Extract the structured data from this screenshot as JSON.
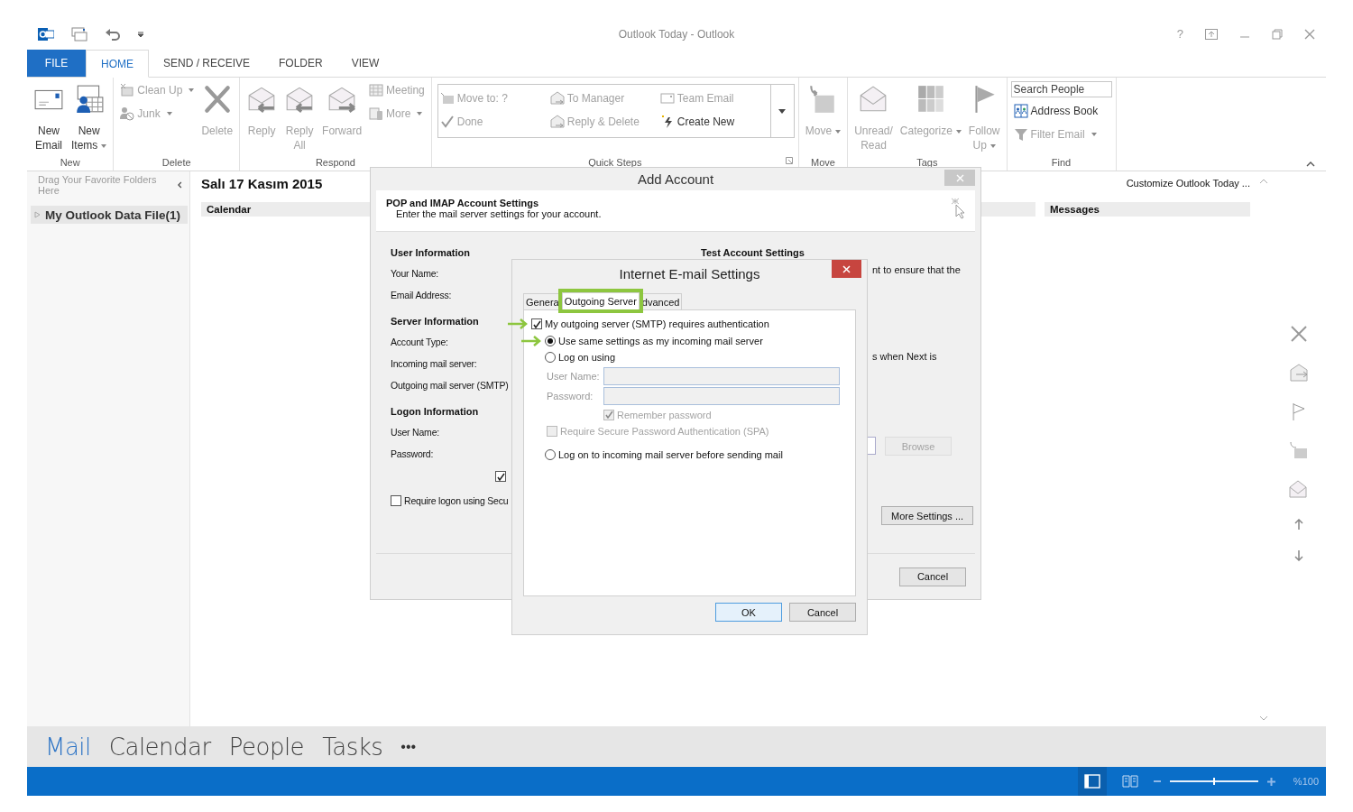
{
  "window": {
    "title": "Outlook Today - Outlook",
    "help": "?"
  },
  "ribbon_tabs": [
    {
      "label": "FILE",
      "kind": "file",
      "selected": false
    },
    {
      "label": "HOME",
      "kind": "tab",
      "selected": true
    },
    {
      "label": "SEND / RECEIVE",
      "kind": "tab",
      "selected": false
    },
    {
      "label": "FOLDER",
      "kind": "tab",
      "selected": false
    },
    {
      "label": "VIEW",
      "kind": "tab",
      "selected": false
    }
  ],
  "ribbon_groups": [
    {
      "label": "New",
      "columns": [
        [
          {
            "kind": "large",
            "label": "New\nEmail",
            "dropdown": false,
            "disabled": false
          }
        ],
        [
          {
            "kind": "large",
            "label": "New\nItems",
            "dropdown": true,
            "disabled": false
          }
        ]
      ]
    },
    {
      "label": "Delete",
      "columns": [
        [
          {
            "kind": "small",
            "label": "Clean Up",
            "dropdown": true,
            "disabled": true
          },
          {
            "kind": "small",
            "label": "Junk",
            "dropdown": true,
            "disabled": true
          }
        ],
        [
          {
            "kind": "large",
            "label": "Delete",
            "dropdown": false,
            "disabled": true
          }
        ]
      ]
    },
    {
      "label": "Respond",
      "columns": [
        [
          {
            "kind": "large",
            "label": "Reply",
            "dropdown": false,
            "disabled": true
          }
        ],
        [
          {
            "kind": "large",
            "label": "Reply\nAll",
            "dropdown": false,
            "disabled": true
          }
        ],
        [
          {
            "kind": "large",
            "label": "Forward",
            "dropdown": false,
            "disabled": true
          }
        ],
        [
          {
            "kind": "small",
            "label": "Meeting",
            "dropdown": false,
            "disabled": true
          },
          {
            "kind": "small",
            "label": "More",
            "dropdown": true,
            "disabled": true
          }
        ]
      ]
    },
    {
      "label": "Quick Steps",
      "launcher": true,
      "gallery": [
        {
          "label": "Move to: ?",
          "disabled": true
        },
        {
          "label": "To Manager",
          "disabled": true
        },
        {
          "label": "Team Email",
          "disabled": true
        },
        {
          "label": "Done",
          "disabled": true
        },
        {
          "label": "Reply & Delete",
          "disabled": true
        },
        {
          "label": "Create New",
          "disabled": false
        }
      ]
    },
    {
      "label": "Move",
      "columns": [
        [
          {
            "kind": "large",
            "label": "Move",
            "dropdown": true,
            "disabled": true
          }
        ]
      ]
    },
    {
      "label": "Tags",
      "columns": [
        [
          {
            "kind": "large",
            "label": "Unread/\nRead",
            "dropdown": false,
            "disabled": true
          }
        ],
        [
          {
            "kind": "large",
            "label": "Categorize",
            "dropdown": true,
            "disabled": true
          }
        ],
        [
          {
            "kind": "large",
            "label": "Follow\nUp",
            "dropdown": true,
            "disabled": true
          }
        ]
      ]
    },
    {
      "label": "Find",
      "columns": [
        [
          {
            "kind": "search",
            "placeholder": "Search People"
          },
          {
            "kind": "small",
            "label": "Address Book",
            "dropdown": false,
            "disabled": false
          },
          {
            "kind": "small",
            "label": "Filter Email",
            "dropdown": true,
            "disabled": true
          }
        ]
      ]
    }
  ],
  "folder_pane": {
    "favorites_hint": "Drag Your Favorite Folders Here",
    "folders": [
      {
        "label": "My Outlook Data File(1)",
        "expanded": false,
        "selected": true
      }
    ]
  },
  "outlook_today": {
    "date": "Salı 17 Kasım 2015",
    "customize_link": "Customize Outlook Today ...",
    "columns": [
      "Calendar",
      "",
      "Messages"
    ]
  },
  "nav": [
    {
      "label": "Mail",
      "selected": true
    },
    {
      "label": "Calendar",
      "selected": false
    },
    {
      "label": "People",
      "selected": false
    },
    {
      "label": "Tasks",
      "selected": false
    }
  ],
  "nav_more": "•••",
  "status_bar": {
    "views": [
      {
        "selected": true
      },
      {
        "selected": false
      }
    ],
    "zoom": {
      "level": 0.5
    },
    "zoom_label": "%100"
  },
  "add_account": {
    "title": "Add Account",
    "heading": "POP and IMAP Account Settings",
    "subheading": "Enter the mail server settings for your account.",
    "sections": [
      {
        "title": "User Information",
        "labels": [
          "Your Name:",
          "Email Address:"
        ]
      },
      {
        "title": "Server Information",
        "labels": [
          "Account Type:",
          "Incoming mail server:",
          "Outgoing mail server (SMTP)"
        ]
      },
      {
        "title": "Logon Information",
        "labels": [
          "User Name:",
          "Password:"
        ]
      }
    ],
    "remember_checkbox": {
      "checked": true
    },
    "spa_checkbox": {
      "label": "Require logon using Secu",
      "checked": false
    },
    "test_title": "Test Account Settings",
    "test_lines": [
      "nt to ensure that the",
      "s when Next is"
    ],
    "browse": "Browse",
    "more_settings": "More Settings ...",
    "cancel": "Cancel"
  },
  "inner_dialog": {
    "title": "Internet E-mail Settings",
    "tabs": [
      {
        "label": "Genera",
        "selected": false,
        "highlighted": false
      },
      {
        "label": "Outgoing Server",
        "selected": true,
        "highlighted": true
      },
      {
        "label": "dvanced",
        "selected": false,
        "highlighted": false
      }
    ],
    "auth": {
      "label": "My outgoing server (SMTP) requires authentication",
      "checked": true,
      "pointed": true,
      "options": [
        {
          "kind": "radio",
          "label": "Use same settings as my incoming mail server",
          "selected": true,
          "pointed": true
        },
        {
          "kind": "radio",
          "label": "Log on using",
          "selected": false,
          "pointed": false,
          "children": [
            {
              "kind": "field",
              "label": "User Name:",
              "disabled": true
            },
            {
              "kind": "field",
              "label": "Password:",
              "disabled": true
            },
            {
              "kind": "subcheckbox",
              "label": "Remember password",
              "checked": true,
              "disabled": true
            },
            {
              "kind": "checkbox",
              "label": "Require Secure Password Authentication (SPA)",
              "checked": false,
              "disabled": true
            }
          ]
        },
        {
          "kind": "radio",
          "label": "Log on to incoming mail server before sending mail",
          "selected": false,
          "pointed": false
        }
      ]
    },
    "buttons": [
      "OK",
      "Cancel"
    ]
  }
}
